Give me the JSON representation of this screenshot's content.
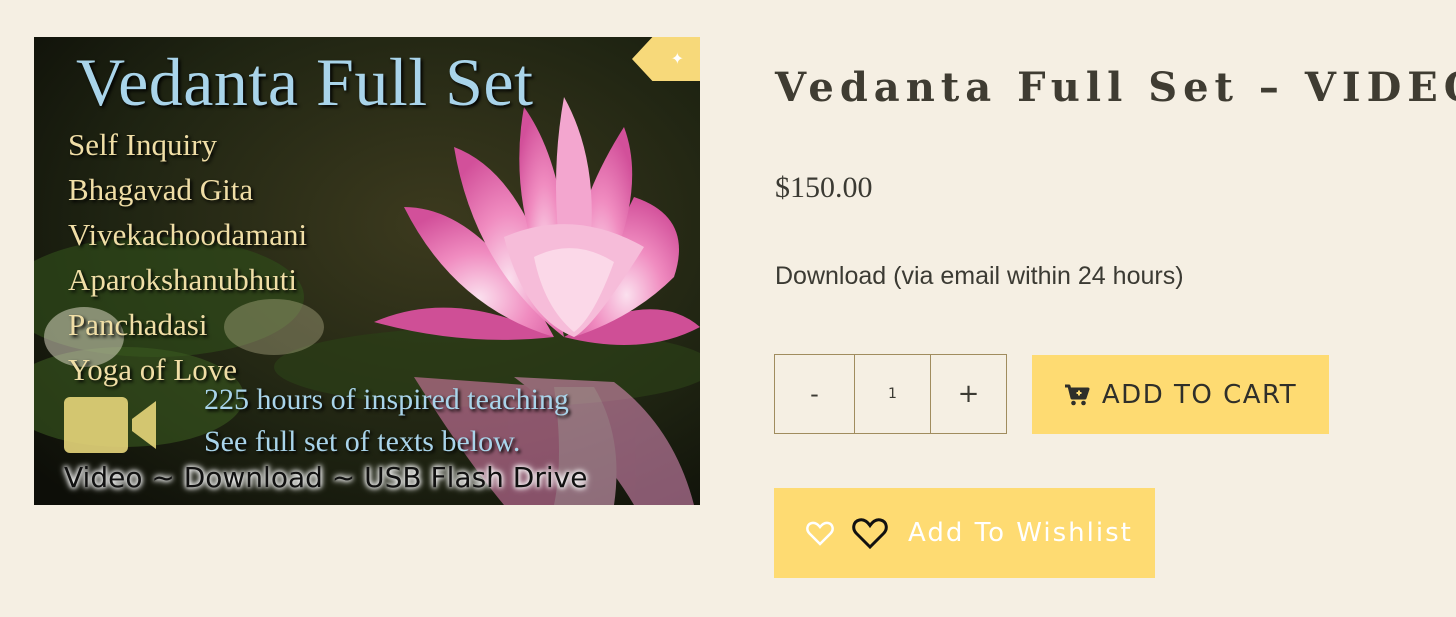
{
  "product": {
    "image": {
      "title": "Vedanta Full Set",
      "courses": [
        "Self Inquiry",
        "Bhagavad Gita",
        "Vivekachoodamani",
        "Aparokshanubhuti",
        "Panchadasi",
        "Yoga of Love"
      ],
      "hours": "225 hours of inspired teaching",
      "see_texts": "See full set of texts below.",
      "formats": "Video ~ Download ~ USB Flash Drive",
      "pin_icon": "pin-icon",
      "camera_icon": "video-camera-icon"
    },
    "title": "Vedanta Full Set – VIDEO",
    "price": "$150.00",
    "variant": "Download (via email within 24 hours)"
  },
  "quantity": {
    "minus": "-",
    "value": "1",
    "plus": "+"
  },
  "cart": {
    "label": "ADD TO CART",
    "icon": "cart-plus-icon"
  },
  "wishlist": {
    "label": "Add To Wishlist",
    "icon": "heart-icon"
  },
  "colors": {
    "background": "#f5efe3",
    "button": "#fedb72",
    "text": "#3b3a33",
    "border": "#a08c5e"
  }
}
